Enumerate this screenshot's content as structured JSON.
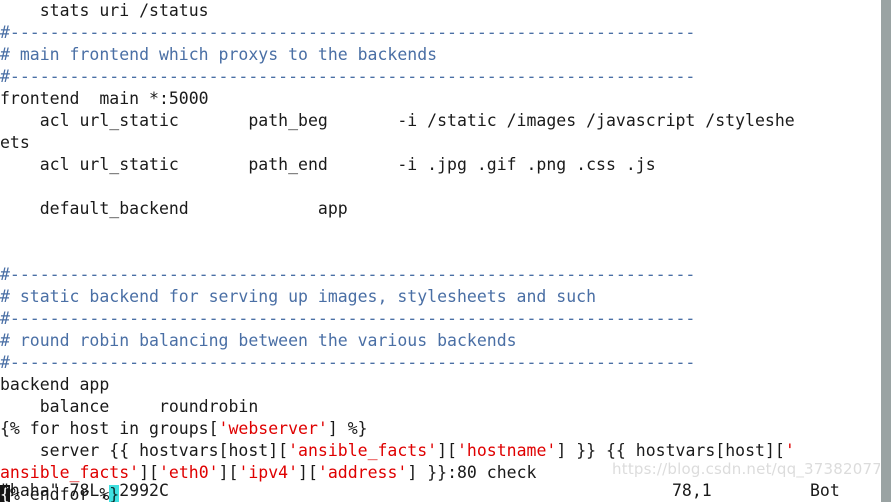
{
  "app": {
    "type": "terminal-text-editor",
    "editor": "vim",
    "colors": {
      "background": "#ffffff",
      "foreground": "#1a1a1a",
      "comment": "#4a6fa5",
      "string": "#df0000",
      "cursor": "#3fe0e0",
      "matching_bracket_bg": "#141414",
      "scrollbar": "#9aa3a3",
      "watermark": "#dcdcdc"
    }
  },
  "buffer": {
    "lines": [
      {
        "id": 0,
        "segments": [
          {
            "t": "    stats uri /status",
            "c": "plain"
          }
        ]
      },
      {
        "id": 1,
        "segments": [
          {
            "t": "#---------------------------------------------------------------------",
            "c": "cmt"
          }
        ]
      },
      {
        "id": 2,
        "segments": [
          {
            "t": "# main frontend which proxys to the backends",
            "c": "cmt"
          }
        ]
      },
      {
        "id": 3,
        "segments": [
          {
            "t": "#---------------------------------------------------------------------",
            "c": "cmt"
          }
        ]
      },
      {
        "id": 4,
        "segments": [
          {
            "t": "frontend  main *:5000",
            "c": "plain"
          }
        ]
      },
      {
        "id": 5,
        "segments": [
          {
            "t": "    acl url_static       path_beg       -i /static /images /javascript /styleshe",
            "c": "plain"
          }
        ]
      },
      {
        "id": 6,
        "segments": [
          {
            "t": "ets",
            "c": "plain"
          }
        ]
      },
      {
        "id": 7,
        "segments": [
          {
            "t": "    acl url_static       path_end       -i .jpg .gif .png .css .js",
            "c": "plain"
          }
        ]
      },
      {
        "id": 8,
        "segments": [
          {
            "t": "",
            "c": "plain"
          }
        ]
      },
      {
        "id": 9,
        "segments": [
          {
            "t": "    default_backend             app",
            "c": "plain"
          }
        ]
      },
      {
        "id": 10,
        "segments": [
          {
            "t": "",
            "c": "plain"
          }
        ]
      },
      {
        "id": 11,
        "segments": [
          {
            "t": "",
            "c": "plain"
          }
        ]
      },
      {
        "id": 12,
        "segments": [
          {
            "t": "#---------------------------------------------------------------------",
            "c": "cmt"
          }
        ]
      },
      {
        "id": 13,
        "segments": [
          {
            "t": "# static backend for serving up images, stylesheets and such",
            "c": "cmt"
          }
        ]
      },
      {
        "id": 14,
        "segments": [
          {
            "t": "#---------------------------------------------------------------------",
            "c": "cmt"
          }
        ]
      },
      {
        "id": 15,
        "segments": [
          {
            "t": "# round robin balancing between the various backends",
            "c": "cmt"
          }
        ]
      },
      {
        "id": 16,
        "segments": [
          {
            "t": "#---------------------------------------------------------------------",
            "c": "cmt"
          }
        ]
      },
      {
        "id": 17,
        "segments": [
          {
            "t": "backend app",
            "c": "plain"
          }
        ]
      },
      {
        "id": 18,
        "segments": [
          {
            "t": "    balance     roundrobin",
            "c": "plain"
          }
        ]
      },
      {
        "id": 19,
        "segments": [
          {
            "t": "{% for host in groups[",
            "c": "plain"
          },
          {
            "t": "'webserver'",
            "c": "str"
          },
          {
            "t": "] %}",
            "c": "plain"
          }
        ]
      },
      {
        "id": 20,
        "segments": [
          {
            "t": "    server {{ hostvars[host][",
            "c": "plain"
          },
          {
            "t": "'ansible_facts'",
            "c": "str"
          },
          {
            "t": "][",
            "c": "plain"
          },
          {
            "t": "'hostname'",
            "c": "str"
          },
          {
            "t": "] }} {{ hostvars[host][",
            "c": "plain"
          },
          {
            "t": "'",
            "c": "str"
          }
        ]
      },
      {
        "id": 21,
        "segments": [
          {
            "t": "ansible_facts'",
            "c": "str"
          },
          {
            "t": "][",
            "c": "plain"
          },
          {
            "t": "'eth0'",
            "c": "str"
          },
          {
            "t": "][",
            "c": "plain"
          },
          {
            "t": "'ipv4'",
            "c": "str"
          },
          {
            "t": "][",
            "c": "plain"
          },
          {
            "t": "'address'",
            "c": "str"
          },
          {
            "t": "] }}:80 check",
            "c": "plain"
          }
        ]
      },
      {
        "id": 22,
        "segments": [
          {
            "t": "{",
            "c": "brk-match"
          },
          {
            "t": "% endfor %",
            "c": "plain"
          },
          {
            "t": "}",
            "c": "cursor"
          }
        ]
      }
    ]
  },
  "statusline": {
    "file_info": "\"haha\" 78L, 2992C",
    "position": "78,1",
    "scroll_percent": "Bot"
  },
  "watermark": {
    "text": "https://blog.csdn.net/qq_37382077"
  },
  "scrollbar": {
    "name": "vertical-scrollbar"
  }
}
